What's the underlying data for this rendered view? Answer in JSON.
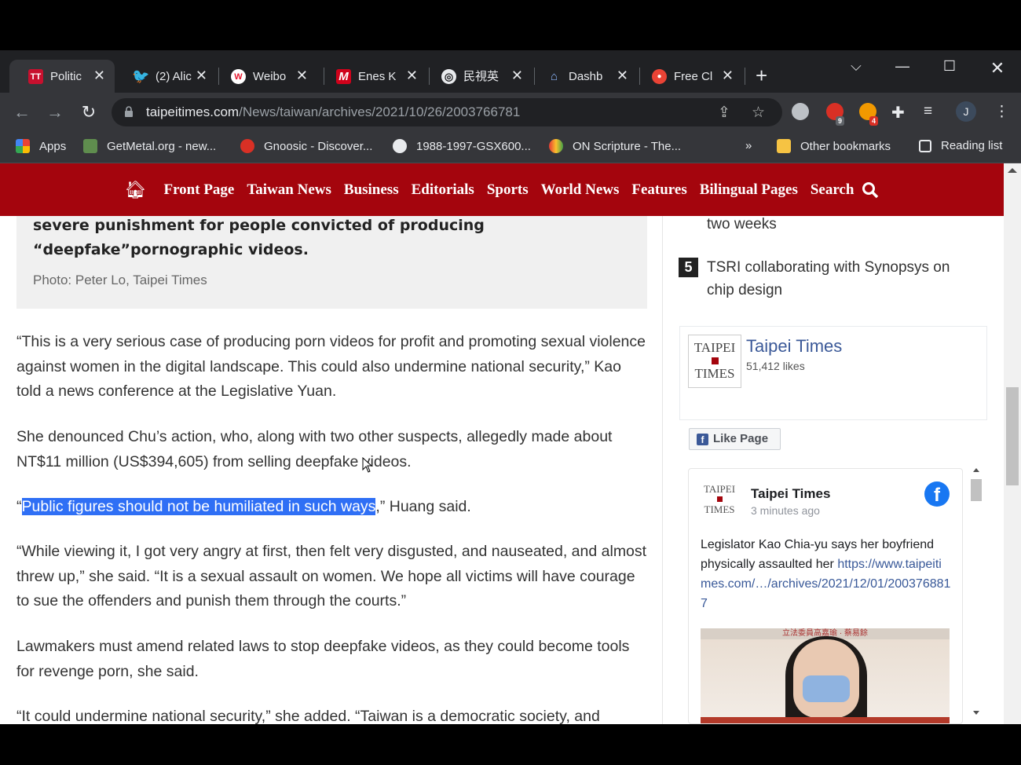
{
  "browser": {
    "tabs": [
      {
        "label": "Politic",
        "icon": "TT",
        "color": "#c8102e"
      },
      {
        "label": "(2) Alic",
        "icon": "twitter",
        "color": "#1da1f2"
      },
      {
        "label": "Weibo",
        "icon": "weibo",
        "color": "#e6162d"
      },
      {
        "label": "Enes K",
        "icon": "M",
        "color": "#d0021b"
      },
      {
        "label": "民視英",
        "icon": "globe",
        "color": "#e8eaed"
      },
      {
        "label": "Dashb",
        "icon": "dash",
        "color": "#8ab4f8"
      },
      {
        "label": "Free Cl",
        "icon": "rec",
        "color": "#ea4335"
      }
    ],
    "url_host": "taipeitimes.com",
    "url_path": "/News/taiwan/archives/2021/10/26/2003766781",
    "ext_badges": [
      "9",
      "4"
    ],
    "profile_initial": "J",
    "bookmarks": [
      "Apps",
      "GetMetal.org - new...",
      "Gnoosic - Discover...",
      "1988-1997-GSX600...",
      "ON Scripture - The..."
    ],
    "other_bookmarks": "Other bookmarks",
    "reading_list": "Reading list",
    "more": "»"
  },
  "nav": {
    "items": [
      "Front Page",
      "Taiwan News",
      "Business",
      "Editorials",
      "Sports",
      "World News",
      "Features",
      "Bilingual Pages",
      "Search"
    ]
  },
  "article": {
    "caption_line1": "severe punishment for people convicted of producing",
    "caption_line2": "“deepfake”pornographic videos.",
    "photo_credit": "Photo: Peter Lo, Taipei Times",
    "p1": "“This is a very serious case of producing porn videos for profit and promoting sexual violence against women in the digital landscape. This could also undermine national security,” Kao told a news conference at the Legislative Yuan.",
    "p2": "She denounced Chu’s action, who, along with two other suspects, allegedly made about NT$11 million (US$394,605) from selling deepfake videos.",
    "p3_open": "“",
    "p3_highlight": "Public figures should not be humiliated in such ways",
    "p3_rest": ",” Huang said.",
    "p4": "“While viewing it, I got very angry at first, then felt very disgusted, and nauseated, and almost threw up,” she said. “It is a sexual assault on women. We hope all victims will have courage to sue the offenders and punish them through the courts.”",
    "p5": "Lawmakers must amend related laws to stop deepfake videos, as they could become tools for revenge porn, she said.",
    "p6": "“It could undermine national security,” she added. “Taiwan is a democratic society, and"
  },
  "sidebar": {
    "item4_tail": "two weeks",
    "item5_rank": "5",
    "item5_text": "TSRI collaborating with Synopsys on chip design",
    "fb": {
      "logo_top": "TAIPEI",
      "logo_bottom": "TIMES",
      "name": "Taipei Times",
      "likes": "51,412 likes",
      "like_button": "Like Page",
      "post_name": "Taipei Times",
      "post_time": "3 minutes ago",
      "post_text": "Legislator Kao Chia-yu says her boyfriend physically assaulted her",
      "post_link": "https://www.taipeitimes.com/…/archives/2021/12/01/2003768817",
      "post_image_caption": "立法委員高嘉瑜 · 蔡易餘"
    }
  }
}
